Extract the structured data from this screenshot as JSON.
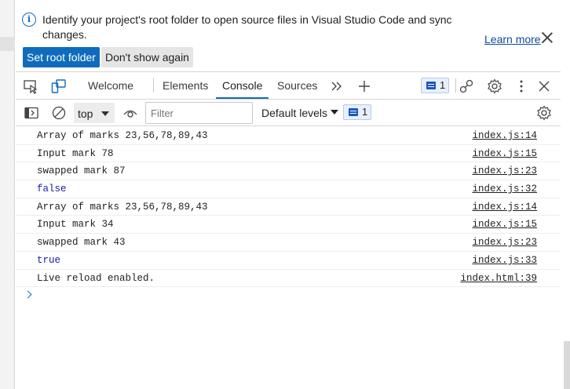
{
  "infobar": {
    "message": "Identify your project's root folder to open source files in Visual Studio Code and sync changes.",
    "learn_more": "Learn more",
    "primary_button": "Set root folder",
    "secondary_button": "Don't show again",
    "info_icon": "i"
  },
  "tabs": [
    {
      "label": "Welcome",
      "active": false
    },
    {
      "label": "Elements",
      "active": false
    },
    {
      "label": "Console",
      "active": true
    },
    {
      "label": "Sources",
      "active": false
    }
  ],
  "tabbar": {
    "issues_count": "1",
    "icons": [
      "inspect-icon",
      "device-emulation-icon",
      "more-tabs-icon",
      "add-tab-icon",
      "performance-icon",
      "settings-icon",
      "more-options-icon",
      "close-icon"
    ]
  },
  "console_toolbar": {
    "context": "top",
    "filter_placeholder": "Filter",
    "levels": "Default levels",
    "message_count": "1"
  },
  "messages": [
    {
      "text": "Array of marks 23,56,78,89,43",
      "source": "index.js:14",
      "type": "log"
    },
    {
      "text": "Input mark 78",
      "source": "index.js:15",
      "type": "log"
    },
    {
      "text": "swapped mark 87",
      "source": "index.js:23",
      "type": "log"
    },
    {
      "text": "false",
      "source": "index.js:32",
      "type": "boolean"
    },
    {
      "text": "Array of marks 23,56,78,89,43",
      "source": "index.js:14",
      "type": "log"
    },
    {
      "text": "Input mark 34",
      "source": "index.js:15",
      "type": "log"
    },
    {
      "text": "swapped mark 43",
      "source": "index.js:23",
      "type": "log"
    },
    {
      "text": "true",
      "source": "index.js:33",
      "type": "boolean"
    },
    {
      "text": "Live reload enabled.",
      "source": "index.html:39",
      "type": "log"
    }
  ],
  "colors": {
    "accent": "#0f6cbd",
    "boolean": "#1a1aa6",
    "badge_bg": "#e8efff"
  }
}
